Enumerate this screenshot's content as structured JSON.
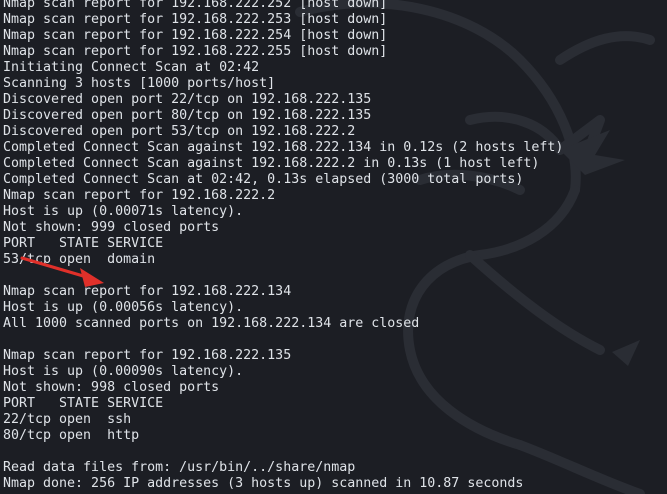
{
  "terminal": {
    "lines": [
      "Nmap scan report for 192.168.222.252 [host down]",
      "Nmap scan report for 192.168.222.253 [host down]",
      "Nmap scan report for 192.168.222.254 [host down]",
      "Nmap scan report for 192.168.222.255 [host down]",
      "Initiating Connect Scan at 02:42",
      "Scanning 3 hosts [1000 ports/host]",
      "Discovered open port 22/tcp on 192.168.222.135",
      "Discovered open port 80/tcp on 192.168.222.135",
      "Discovered open port 53/tcp on 192.168.222.2",
      "Completed Connect Scan against 192.168.222.134 in 0.12s (2 hosts left)",
      "Completed Connect Scan against 192.168.222.2 in 0.13s (1 host left)",
      "Completed Connect Scan at 02:42, 0.13s elapsed (3000 total ports)",
      "Nmap scan report for 192.168.222.2",
      "Host is up (0.00071s latency).",
      "Not shown: 999 closed ports",
      "PORT   STATE SERVICE",
      "53/tcp open  domain",
      "",
      "Nmap scan report for 192.168.222.134",
      "Host is up (0.00056s latency).",
      "All 1000 scanned ports on 192.168.222.134 are closed",
      "",
      "Nmap scan report for 192.168.222.135",
      "Host is up (0.00090s latency).",
      "Not shown: 998 closed ports",
      "PORT   STATE SERVICE",
      "22/tcp open  ssh",
      "80/tcp open  http",
      "",
      "Read data files from: /usr/bin/../share/nmap",
      "Nmap done: 256 IP addresses (3 hosts up) scanned in 10.87 seconds"
    ]
  },
  "colors": {
    "background": "#1c1e24",
    "text": "#dfe3e8",
    "annotation_arrow": "#e0302a",
    "watermark": "#2b2e35"
  },
  "icons": {
    "watermark": "kali-dragon-icon",
    "annotation": "red-arrow-icon"
  }
}
